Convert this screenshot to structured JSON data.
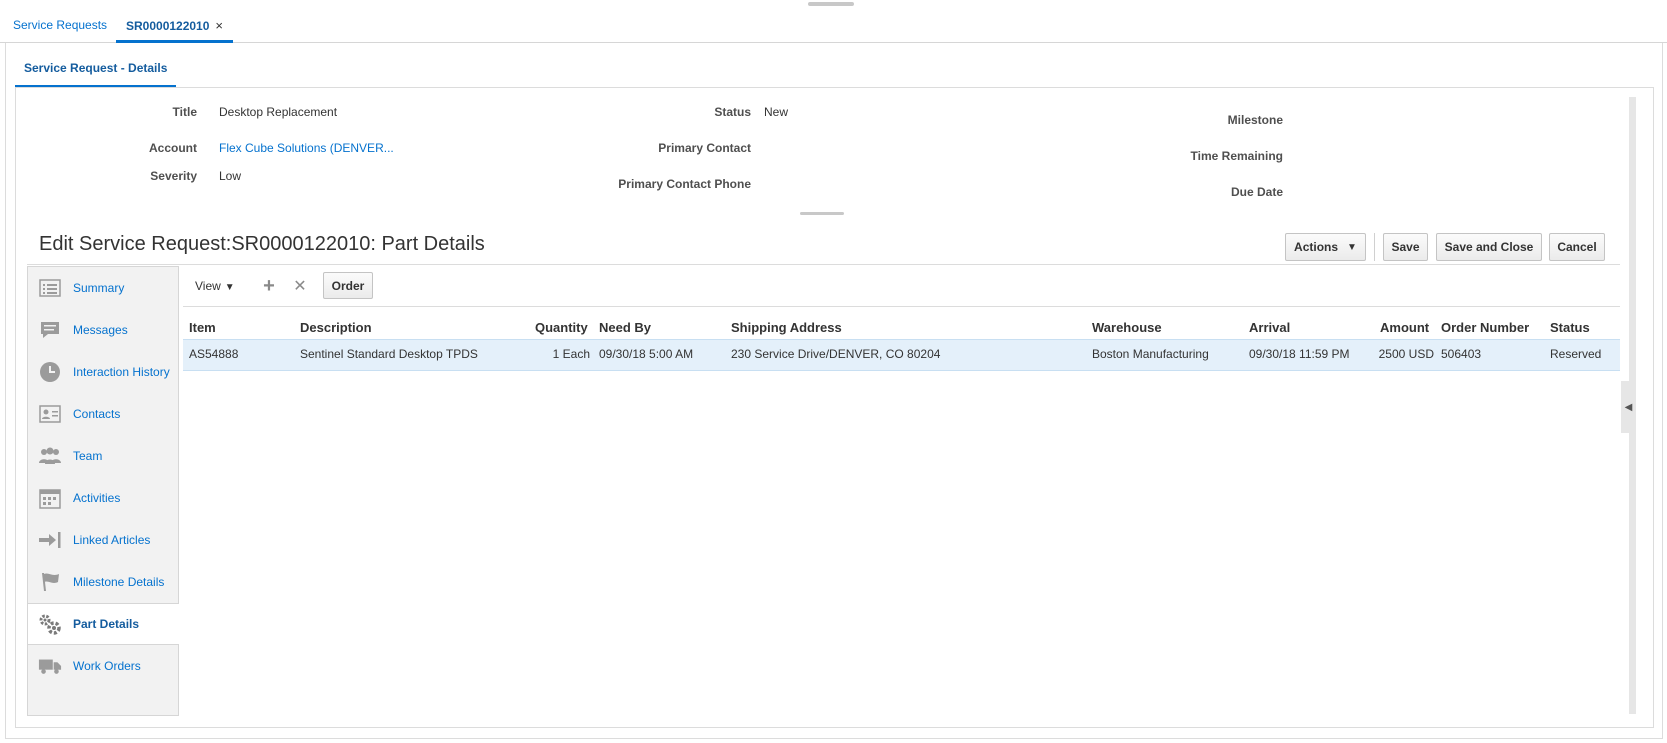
{
  "tabs": {
    "service_requests": "Service Requests",
    "active": "SR0000122010",
    "close_glyph": "×"
  },
  "subtab": "Service Request - Details",
  "header": {
    "title_label": "Title",
    "title_value": "Desktop Replacement",
    "account_label": "Account",
    "account_value": "Flex Cube Solutions (DENVER...",
    "severity_label": "Severity",
    "severity_value": "Low",
    "status_label": "Status",
    "status_value": "New",
    "primary_contact_label": "Primary Contact",
    "primary_contact_phone_label": "Primary Contact Phone",
    "milestone_label": "Milestone",
    "time_remaining_label": "Time Remaining",
    "due_date_label": "Due Date"
  },
  "page_title": "Edit Service Request:SR0000122010: Part Details",
  "actions": {
    "actions": "Actions",
    "caret": "▼",
    "save": "Save",
    "save_and_close": "Save and Close",
    "cancel": "Cancel"
  },
  "sidebar": {
    "items": [
      {
        "label": "Summary",
        "icon": "summary-icon"
      },
      {
        "label": "Messages",
        "icon": "messages-icon"
      },
      {
        "label": "Interaction History",
        "icon": "interaction-history-icon"
      },
      {
        "label": "Contacts",
        "icon": "contacts-icon"
      },
      {
        "label": "Team",
        "icon": "team-icon"
      },
      {
        "label": "Activities",
        "icon": "activities-icon"
      },
      {
        "label": "Linked Articles",
        "icon": "linked-articles-icon"
      },
      {
        "label": "Milestone Details",
        "icon": "milestone-icon"
      },
      {
        "label": "Part Details",
        "icon": "gears-icon",
        "active": true
      },
      {
        "label": "Work Orders",
        "icon": "truck-icon"
      }
    ]
  },
  "toolbar": {
    "view": "View",
    "caret": "▼",
    "add_glyph": "+",
    "remove_glyph": "✕",
    "order": "Order"
  },
  "table": {
    "headers": {
      "item": "Item",
      "description": "Description",
      "quantity": "Quantity",
      "need_by": "Need By",
      "shipping_address": "Shipping Address",
      "warehouse": "Warehouse",
      "arrival": "Arrival",
      "amount": "Amount",
      "order_number": "Order Number",
      "status": "Status"
    },
    "rows": [
      {
        "item": "AS54888",
        "description": "Sentinel Standard Desktop TPDS",
        "quantity": "1 Each",
        "need_by": "09/30/18 5:00 AM",
        "shipping_address": "230 Service Drive/DENVER, CO 80204",
        "warehouse": "Boston Manufacturing",
        "arrival": "09/30/18 11:59 PM",
        "amount": "2500 USD",
        "order_number": "506403",
        "status": "Reserved"
      }
    ]
  },
  "collapse_glyph": "◀",
  "colors": {
    "link": "#0572ce",
    "accent": "#0572ce",
    "selected_row": "#e4f0fa"
  }
}
